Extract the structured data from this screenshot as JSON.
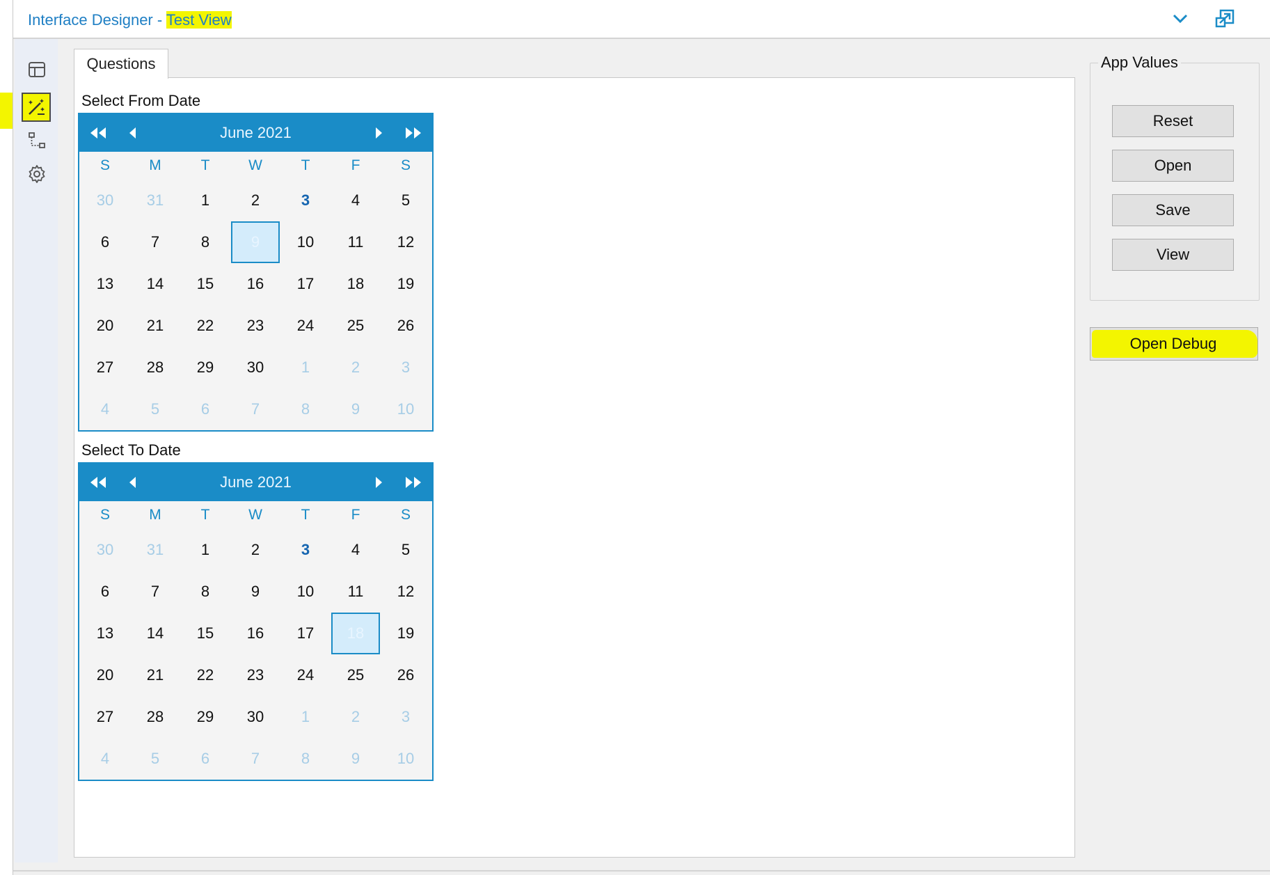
{
  "window": {
    "title_prefix": "Interface Designer - ",
    "title_highlight": "Test View"
  },
  "sidebar": {
    "items": [
      {
        "icon": "layout-icon"
      },
      {
        "icon": "magic-wand-icon",
        "active": true
      },
      {
        "icon": "tree-icon"
      },
      {
        "icon": "gear-icon"
      }
    ]
  },
  "tabs": [
    {
      "label": "Questions"
    }
  ],
  "questions": {
    "from_label": "Select From Date",
    "to_label": "Select To Date"
  },
  "calendars": [
    {
      "month": "June 2021",
      "dow": [
        "S",
        "M",
        "T",
        "W",
        "T",
        "F",
        "S"
      ],
      "days": [
        {
          "d": "30",
          "o": 1
        },
        {
          "d": "31",
          "o": 1
        },
        {
          "d": "1"
        },
        {
          "d": "2"
        },
        {
          "d": "3",
          "t": 1
        },
        {
          "d": "4"
        },
        {
          "d": "5"
        },
        {
          "d": "6"
        },
        {
          "d": "7"
        },
        {
          "d": "8"
        },
        {
          "d": "9",
          "s": 1
        },
        {
          "d": "10"
        },
        {
          "d": "11"
        },
        {
          "d": "12"
        },
        {
          "d": "13"
        },
        {
          "d": "14"
        },
        {
          "d": "15"
        },
        {
          "d": "16"
        },
        {
          "d": "17"
        },
        {
          "d": "18"
        },
        {
          "d": "19"
        },
        {
          "d": "20"
        },
        {
          "d": "21"
        },
        {
          "d": "22"
        },
        {
          "d": "23"
        },
        {
          "d": "24"
        },
        {
          "d": "25"
        },
        {
          "d": "26"
        },
        {
          "d": "27"
        },
        {
          "d": "28"
        },
        {
          "d": "29"
        },
        {
          "d": "30"
        },
        {
          "d": "1",
          "o": 1
        },
        {
          "d": "2",
          "o": 1
        },
        {
          "d": "3",
          "o": 1
        },
        {
          "d": "4",
          "o": 1
        },
        {
          "d": "5",
          "o": 1
        },
        {
          "d": "6",
          "o": 1
        },
        {
          "d": "7",
          "o": 1
        },
        {
          "d": "8",
          "o": 1
        },
        {
          "d": "9",
          "o": 1
        },
        {
          "d": "10",
          "o": 1
        }
      ]
    },
    {
      "month": "June 2021",
      "dow": [
        "S",
        "M",
        "T",
        "W",
        "T",
        "F",
        "S"
      ],
      "days": [
        {
          "d": "30",
          "o": 1
        },
        {
          "d": "31",
          "o": 1
        },
        {
          "d": "1"
        },
        {
          "d": "2"
        },
        {
          "d": "3",
          "t": 1
        },
        {
          "d": "4"
        },
        {
          "d": "5"
        },
        {
          "d": "6"
        },
        {
          "d": "7"
        },
        {
          "d": "8"
        },
        {
          "d": "9"
        },
        {
          "d": "10"
        },
        {
          "d": "11"
        },
        {
          "d": "12"
        },
        {
          "d": "13"
        },
        {
          "d": "14"
        },
        {
          "d": "15"
        },
        {
          "d": "16"
        },
        {
          "d": "17"
        },
        {
          "d": "18",
          "s": 1
        },
        {
          "d": "19"
        },
        {
          "d": "20"
        },
        {
          "d": "21"
        },
        {
          "d": "22"
        },
        {
          "d": "23"
        },
        {
          "d": "24"
        },
        {
          "d": "25"
        },
        {
          "d": "26"
        },
        {
          "d": "27"
        },
        {
          "d": "28"
        },
        {
          "d": "29"
        },
        {
          "d": "30"
        },
        {
          "d": "1",
          "o": 1
        },
        {
          "d": "2",
          "o": 1
        },
        {
          "d": "3",
          "o": 1
        },
        {
          "d": "4",
          "o": 1
        },
        {
          "d": "5",
          "o": 1
        },
        {
          "d": "6",
          "o": 1
        },
        {
          "d": "7",
          "o": 1
        },
        {
          "d": "8",
          "o": 1
        },
        {
          "d": "9",
          "o": 1
        },
        {
          "d": "10",
          "o": 1
        }
      ]
    }
  ],
  "app_values": {
    "title": "App Values",
    "buttons": [
      "Reset",
      "Open",
      "Save",
      "View"
    ]
  },
  "debug": {
    "label": "Open Debug"
  },
  "colors": {
    "accent": "#1a8cc7",
    "highlight": "#f3f500"
  }
}
